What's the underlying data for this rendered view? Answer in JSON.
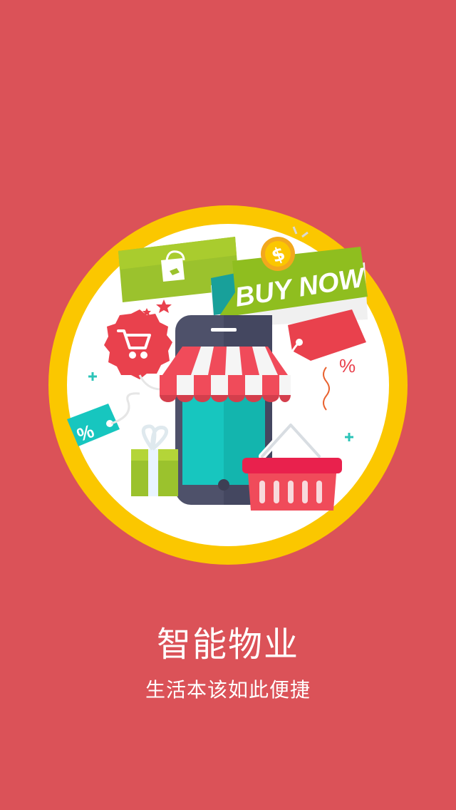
{
  "splash": {
    "title": "智能物业",
    "subtitle": "生活本该如此便捷",
    "banner_text": "BUY NOW",
    "tag_left_text": "%",
    "tag_right_text": "%",
    "coin_symbol": "$",
    "background_color": "#db5258",
    "ring_color": "#fbc700",
    "illustration_icons": [
      "shopping-bag-icon",
      "shopping-cart-icon",
      "coin-icon",
      "smartphone-icon",
      "awning-icon",
      "shopping-basket-icon",
      "gift-box-icon",
      "price-tag-icon",
      "percent-icon"
    ]
  }
}
